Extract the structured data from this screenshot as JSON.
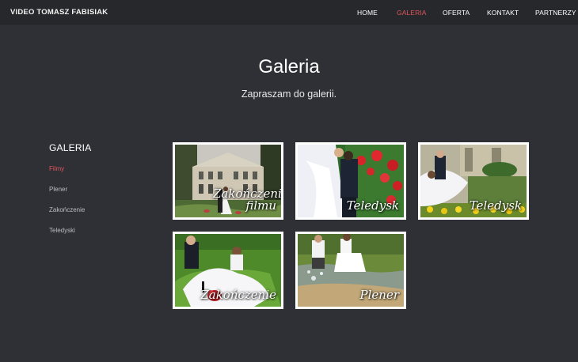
{
  "header": {
    "brand": "VIDEO TOMASZ FABISIAK",
    "nav": [
      {
        "label": "HOME",
        "active": false
      },
      {
        "label": "GALERIA",
        "active": true
      },
      {
        "label": "OFERTA",
        "active": false
      },
      {
        "label": "KONTAKT",
        "active": false
      },
      {
        "label": "PARTNERZY",
        "active": false
      }
    ]
  },
  "main": {
    "title": "Galeria",
    "subtitle": "Zapraszam do galerii."
  },
  "sidebar": {
    "title": "GALERIA",
    "items": [
      {
        "label": "Filmy",
        "active": true
      },
      {
        "label": "Plener",
        "active": false
      },
      {
        "label": "Zakończenie",
        "active": false
      },
      {
        "label": "Teledyski",
        "active": false
      }
    ]
  },
  "gallery": {
    "tiles": [
      {
        "caption": "Zakończenie filmu",
        "scene": "palace"
      },
      {
        "caption": "Teledysk",
        "scene": "roses"
      },
      {
        "caption": "Teledysk",
        "scene": "garden"
      },
      {
        "caption": "Zakończenie",
        "scene": "picnic"
      },
      {
        "caption": "Plener",
        "scene": "water"
      }
    ]
  },
  "colors": {
    "background": "#2e3035",
    "topbar": "#26282c",
    "accent": "#e0565b",
    "muted_link": "#b9bcc2"
  }
}
